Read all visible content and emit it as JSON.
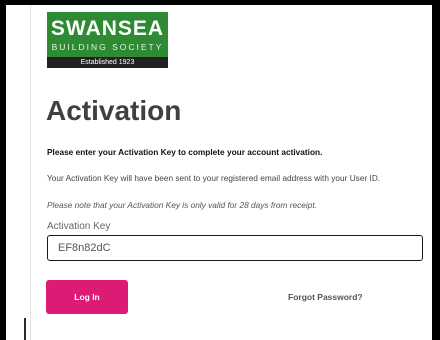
{
  "brand": {
    "name": "SWANSEA",
    "subtitle": "BUILDING SOCIETY",
    "established": "Established 1923",
    "colors": {
      "green": "#2e8b33",
      "dark_band": "#222222"
    }
  },
  "page": {
    "title": "Activation",
    "instruction": "Please enter your Activation Key to complete your account activation.",
    "sent_info": "Your Activation Key will have been sent to your registered email address with your User ID.",
    "validity_note": "Please note that your Activation Key is only valid for 28 days from receipt."
  },
  "form": {
    "activation_key_label": "Activation Key",
    "activation_key_value": "EF8n82dC",
    "login_label": "Log In",
    "forgot_password_label": "Forgot Password?"
  },
  "colors": {
    "primary_button": "#dd1a74",
    "title_text": "#404040"
  }
}
